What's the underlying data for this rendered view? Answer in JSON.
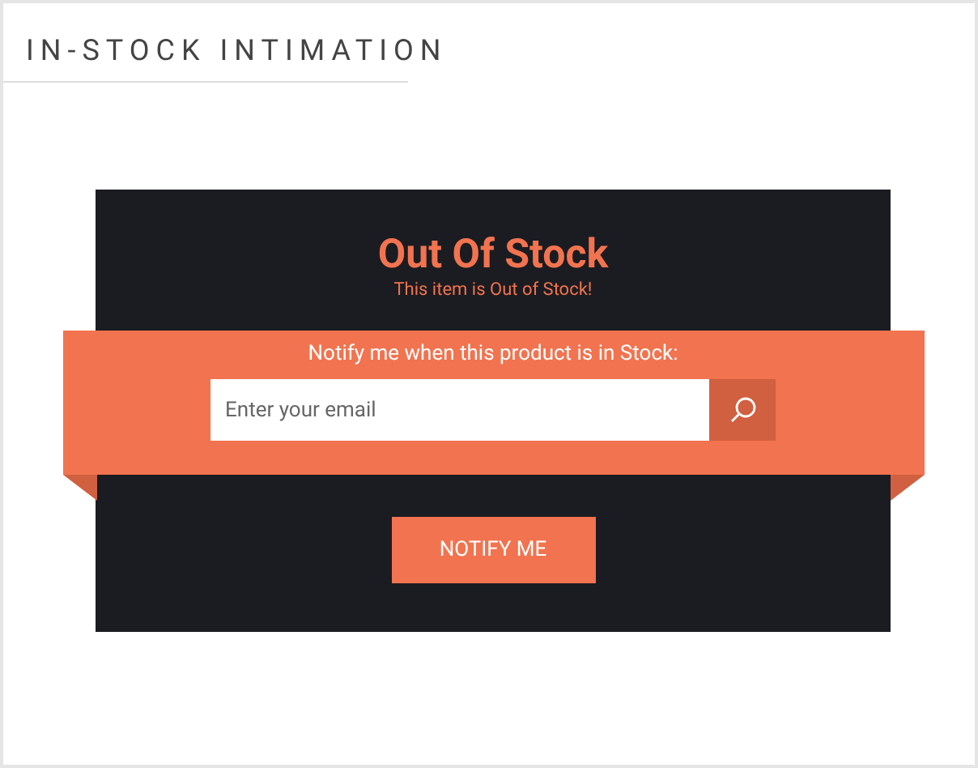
{
  "header": {
    "title": "IN-STOCK INTIMATION"
  },
  "card": {
    "title": "Out Of Stock",
    "subtitle": "This item is Out of Stock!",
    "ribbon": {
      "prompt": "Notify me when this product is in Stock:",
      "email": {
        "placeholder": "Enter your email"
      }
    },
    "button": "NOTIFY ME"
  }
}
